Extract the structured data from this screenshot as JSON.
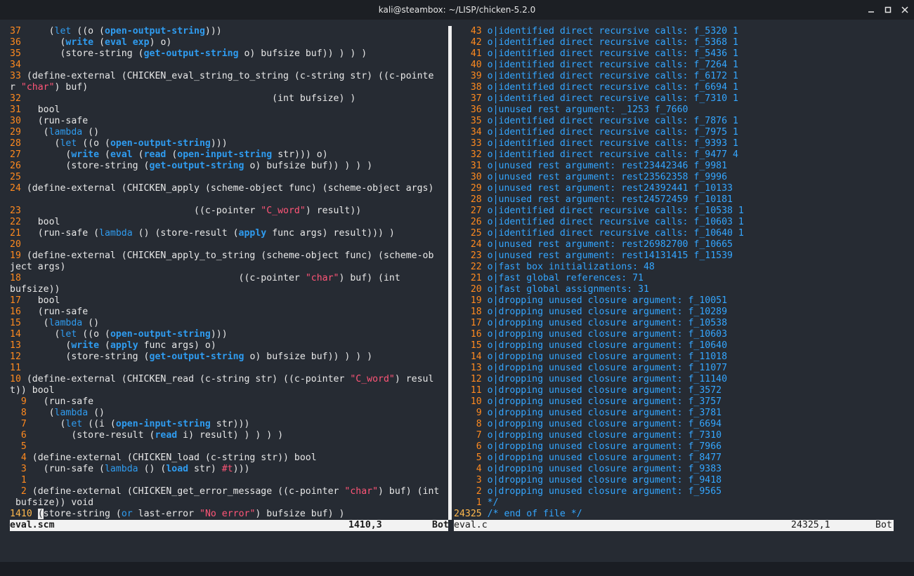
{
  "window": {
    "title": "kali@steambox: ~/LISP/chicken-5.2.0"
  },
  "left_pane": {
    "lines": [
      [
        [
          "ln",
          "37"
        ],
        [
          "pl",
          "     ("
        ],
        [
          "kw",
          "let"
        ],
        [
          "pl",
          " ((o ("
        ],
        [
          "fn",
          "open-output-string"
        ],
        [
          "pl",
          ")))"
        ]
      ],
      [
        [
          "ln",
          "36"
        ],
        [
          "pl",
          "       ("
        ],
        [
          "fn",
          "write"
        ],
        [
          "pl",
          " ("
        ],
        [
          "fn",
          "eval"
        ],
        [
          "pl",
          " "
        ],
        [
          "fn",
          "exp"
        ],
        [
          "pl",
          ") o)"
        ]
      ],
      [
        [
          "ln",
          "35"
        ],
        [
          "pl",
          "       (store-string ("
        ],
        [
          "fn",
          "get-output-string"
        ],
        [
          "pl",
          " o) bufsize buf)) ) ) )"
        ]
      ],
      [
        [
          "ln",
          "34"
        ]
      ],
      [
        [
          "ln",
          "33"
        ],
        [
          "pl",
          " (define-external (CHICKEN_eval_string_to_string (c-string str) ((c-pointe"
        ]
      ],
      [
        [
          "pl",
          "r "
        ],
        [
          "str",
          "\"char\""
        ],
        [
          "pl",
          ") buf)"
        ]
      ],
      [
        [
          "ln",
          "32"
        ],
        [
          "pl",
          "                                             (int bufsize) )"
        ]
      ],
      [
        [
          "ln",
          "31"
        ],
        [
          "pl",
          "   bool"
        ]
      ],
      [
        [
          "ln",
          "30"
        ],
        [
          "pl",
          "   (run-safe"
        ]
      ],
      [
        [
          "ln",
          "29"
        ],
        [
          "pl",
          "    ("
        ],
        [
          "kw",
          "lambda"
        ],
        [
          "pl",
          " ()"
        ]
      ],
      [
        [
          "ln",
          "28"
        ],
        [
          "pl",
          "      ("
        ],
        [
          "kw",
          "let"
        ],
        [
          "pl",
          " ((o ("
        ],
        [
          "fn",
          "open-output-string"
        ],
        [
          "pl",
          ")))"
        ]
      ],
      [
        [
          "ln",
          "27"
        ],
        [
          "pl",
          "        ("
        ],
        [
          "fn",
          "write"
        ],
        [
          "pl",
          " ("
        ],
        [
          "fn",
          "eval"
        ],
        [
          "pl",
          " ("
        ],
        [
          "fn",
          "read"
        ],
        [
          "pl",
          " ("
        ],
        [
          "fn",
          "open-input-string"
        ],
        [
          "pl",
          " str))) o)"
        ]
      ],
      [
        [
          "ln",
          "26"
        ],
        [
          "pl",
          "        (store-string ("
        ],
        [
          "fn",
          "get-output-string"
        ],
        [
          "pl",
          " o) bufsize buf)) ) ) )"
        ]
      ],
      [
        [
          "ln",
          "25"
        ]
      ],
      [
        [
          "ln",
          "24"
        ],
        [
          "pl",
          " (define-external (CHICKEN_apply (scheme-object func) (scheme-object args)"
        ]
      ],
      [],
      [
        [
          "ln",
          "23"
        ],
        [
          "pl",
          "                               ((c-pointer "
        ],
        [
          "str",
          "\"C_word\""
        ],
        [
          "pl",
          ") result))"
        ]
      ],
      [
        [
          "ln",
          "22"
        ],
        [
          "pl",
          "   bool"
        ]
      ],
      [
        [
          "ln",
          "21"
        ],
        [
          "pl",
          "   (run-safe ("
        ],
        [
          "kw",
          "lambda"
        ],
        [
          "pl",
          " () (store-result ("
        ],
        [
          "fn",
          "apply"
        ],
        [
          "pl",
          " func args) result))) )"
        ]
      ],
      [
        [
          "ln",
          "20"
        ]
      ],
      [
        [
          "ln",
          "19"
        ],
        [
          "pl",
          " (define-external (CHICKEN_apply_to_string (scheme-object func) (scheme-ob"
        ]
      ],
      [
        [
          "pl",
          "ject args)"
        ]
      ],
      [
        [
          "ln",
          "18"
        ],
        [
          "pl",
          "                                       ((c-pointer "
        ],
        [
          "str",
          "\"char\""
        ],
        [
          "pl",
          ") buf) (int"
        ]
      ],
      [
        [
          "pl",
          "bufsize))"
        ]
      ],
      [
        [
          "ln",
          "17"
        ],
        [
          "pl",
          "   bool"
        ]
      ],
      [
        [
          "ln",
          "16"
        ],
        [
          "pl",
          "   (run-safe"
        ]
      ],
      [
        [
          "ln",
          "15"
        ],
        [
          "pl",
          "    ("
        ],
        [
          "kw",
          "lambda"
        ],
        [
          "pl",
          " ()"
        ]
      ],
      [
        [
          "ln",
          "14"
        ],
        [
          "pl",
          "      ("
        ],
        [
          "kw",
          "let"
        ],
        [
          "pl",
          " ((o ("
        ],
        [
          "fn",
          "open-output-string"
        ],
        [
          "pl",
          ")))"
        ]
      ],
      [
        [
          "ln",
          "13"
        ],
        [
          "pl",
          "        ("
        ],
        [
          "fn",
          "write"
        ],
        [
          "pl",
          " ("
        ],
        [
          "fn",
          "apply"
        ],
        [
          "pl",
          " func args) o)"
        ]
      ],
      [
        [
          "ln",
          "12"
        ],
        [
          "pl",
          "        (store-string ("
        ],
        [
          "fn",
          "get-output-string"
        ],
        [
          "pl",
          " o) bufsize buf)) ) ) )"
        ]
      ],
      [
        [
          "ln",
          "11"
        ]
      ],
      [
        [
          "ln",
          "10"
        ],
        [
          "pl",
          " (define-external (CHICKEN_read (c-string str) ((c-pointer "
        ],
        [
          "str",
          "\"C_word\""
        ],
        [
          "pl",
          ") resul"
        ]
      ],
      [
        [
          "pl",
          "t)) bool"
        ]
      ],
      [
        [
          "ln",
          "  9"
        ],
        [
          "pl",
          "   (run-safe"
        ]
      ],
      [
        [
          "ln",
          "  8"
        ],
        [
          "pl",
          "    ("
        ],
        [
          "kw",
          "lambda"
        ],
        [
          "pl",
          " ()"
        ]
      ],
      [
        [
          "ln",
          "  7"
        ],
        [
          "pl",
          "      ("
        ],
        [
          "kw",
          "let"
        ],
        [
          "pl",
          " ((i ("
        ],
        [
          "fn",
          "open-input-string"
        ],
        [
          "pl",
          " str)))"
        ]
      ],
      [
        [
          "ln",
          "  6"
        ],
        [
          "pl",
          "        (store-result ("
        ],
        [
          "fn",
          "read"
        ],
        [
          "pl",
          " i) result) ) ) ) )"
        ]
      ],
      [
        [
          "ln",
          "  5"
        ]
      ],
      [
        [
          "ln",
          "  4"
        ],
        [
          "pl",
          " (define-external (CHICKEN_load (c-string str)) bool"
        ]
      ],
      [
        [
          "ln",
          "  3"
        ],
        [
          "pl",
          "   (run-safe ("
        ],
        [
          "kw",
          "lambda"
        ],
        [
          "pl",
          " () ("
        ],
        [
          "fn",
          "load"
        ],
        [
          "pl",
          " str) "
        ],
        [
          "str",
          "#t"
        ],
        [
          "pl",
          ")))"
        ]
      ],
      [
        [
          "ln",
          "  1"
        ]
      ],
      [
        [
          "ln",
          "  2"
        ],
        [
          "pl",
          " (define-external (CHICKEN_get_error_message ((c-pointer "
        ],
        [
          "str",
          "\"char\""
        ],
        [
          "pl",
          ") buf) (int"
        ]
      ],
      [
        [
          "pl",
          " bufsize)) void"
        ]
      ],
      [
        [
          "ln-cur",
          "1410"
        ],
        [
          "pl",
          " "
        ],
        [
          "cursor",
          "("
        ],
        [
          "pl",
          "store-string ("
        ],
        [
          "kw",
          "or"
        ],
        [
          "pl",
          " last-error "
        ],
        [
          "str",
          "\"No error\""
        ],
        [
          "pl",
          ") bufsize buf) )"
        ]
      ]
    ]
  },
  "right_pane": {
    "lines": [
      [
        [
          "ln",
          "   43"
        ],
        [
          "pl",
          " "
        ],
        [
          "com",
          "o|identified direct recursive calls: f_5320 1"
        ]
      ],
      [
        [
          "ln",
          "   42"
        ],
        [
          "pl",
          " "
        ],
        [
          "com",
          "o|identified direct recursive calls: f_5368 1"
        ]
      ],
      [
        [
          "ln",
          "   41"
        ],
        [
          "pl",
          " "
        ],
        [
          "com",
          "o|identified direct recursive calls: f_5436 1"
        ]
      ],
      [
        [
          "ln",
          "   40"
        ],
        [
          "pl",
          " "
        ],
        [
          "com",
          "o|identified direct recursive calls: f_7264 1"
        ]
      ],
      [
        [
          "ln",
          "   39"
        ],
        [
          "pl",
          " "
        ],
        [
          "com",
          "o|identified direct recursive calls: f_6172 1"
        ]
      ],
      [
        [
          "ln",
          "   38"
        ],
        [
          "pl",
          " "
        ],
        [
          "com",
          "o|identified direct recursive calls: f_6694 1"
        ]
      ],
      [
        [
          "ln",
          "   37"
        ],
        [
          "pl",
          " "
        ],
        [
          "com",
          "o|identified direct recursive calls: f_7310 1"
        ]
      ],
      [
        [
          "ln",
          "   36"
        ],
        [
          "pl",
          " "
        ],
        [
          "com",
          "o|unused rest argument: _1253 f_7660"
        ]
      ],
      [
        [
          "ln",
          "   35"
        ],
        [
          "pl",
          " "
        ],
        [
          "com",
          "o|identified direct recursive calls: f_7876 1"
        ]
      ],
      [
        [
          "ln",
          "   34"
        ],
        [
          "pl",
          " "
        ],
        [
          "com",
          "o|identified direct recursive calls: f_7975 1"
        ]
      ],
      [
        [
          "ln",
          "   33"
        ],
        [
          "pl",
          " "
        ],
        [
          "com",
          "o|identified direct recursive calls: f_9393 1"
        ]
      ],
      [
        [
          "ln",
          "   32"
        ],
        [
          "pl",
          " "
        ],
        [
          "com",
          "o|identified direct recursive calls: f_9477 4"
        ]
      ],
      [
        [
          "ln",
          "   31"
        ],
        [
          "pl",
          " "
        ],
        [
          "com",
          "o|unused rest argument: rest23442346 f_9981"
        ]
      ],
      [
        [
          "ln",
          "   30"
        ],
        [
          "pl",
          " "
        ],
        [
          "com",
          "o|unused rest argument: rest23562358 f_9996"
        ]
      ],
      [
        [
          "ln",
          "   29"
        ],
        [
          "pl",
          " "
        ],
        [
          "com",
          "o|unused rest argument: rest24392441 f_10133"
        ]
      ],
      [
        [
          "ln",
          "   28"
        ],
        [
          "pl",
          " "
        ],
        [
          "com",
          "o|unused rest argument: rest24572459 f_10181"
        ]
      ],
      [
        [
          "ln",
          "   27"
        ],
        [
          "pl",
          " "
        ],
        [
          "com",
          "o|identified direct recursive calls: f_10538 1"
        ]
      ],
      [
        [
          "ln",
          "   26"
        ],
        [
          "pl",
          " "
        ],
        [
          "com",
          "o|identified direct recursive calls: f_10603 1"
        ]
      ],
      [
        [
          "ln",
          "   25"
        ],
        [
          "pl",
          " "
        ],
        [
          "com",
          "o|identified direct recursive calls: f_10640 1"
        ]
      ],
      [
        [
          "ln",
          "   24"
        ],
        [
          "pl",
          " "
        ],
        [
          "com",
          "o|unused rest argument: rest26982700 f_10665"
        ]
      ],
      [
        [
          "ln",
          "   23"
        ],
        [
          "pl",
          " "
        ],
        [
          "com",
          "o|unused rest argument: rest14131415 f_11539"
        ]
      ],
      [
        [
          "ln",
          "   22"
        ],
        [
          "pl",
          " "
        ],
        [
          "com",
          "o|fast box initializations: 48"
        ]
      ],
      [
        [
          "ln",
          "   21"
        ],
        [
          "pl",
          " "
        ],
        [
          "com",
          "o|fast global references: 71"
        ]
      ],
      [
        [
          "ln",
          "   20"
        ],
        [
          "pl",
          " "
        ],
        [
          "com",
          "o|fast global assignments: 31"
        ]
      ],
      [
        [
          "ln",
          "   19"
        ],
        [
          "pl",
          " "
        ],
        [
          "com",
          "o|dropping unused closure argument: f_10051"
        ]
      ],
      [
        [
          "ln",
          "   18"
        ],
        [
          "pl",
          " "
        ],
        [
          "com",
          "o|dropping unused closure argument: f_10289"
        ]
      ],
      [
        [
          "ln",
          "   17"
        ],
        [
          "pl",
          " "
        ],
        [
          "com",
          "o|dropping unused closure argument: f_10538"
        ]
      ],
      [
        [
          "ln",
          "   16"
        ],
        [
          "pl",
          " "
        ],
        [
          "com",
          "o|dropping unused closure argument: f_10603"
        ]
      ],
      [
        [
          "ln",
          "   15"
        ],
        [
          "pl",
          " "
        ],
        [
          "com",
          "o|dropping unused closure argument: f_10640"
        ]
      ],
      [
        [
          "ln",
          "   14"
        ],
        [
          "pl",
          " "
        ],
        [
          "com",
          "o|dropping unused closure argument: f_11018"
        ]
      ],
      [
        [
          "ln",
          "   13"
        ],
        [
          "pl",
          " "
        ],
        [
          "com",
          "o|dropping unused closure argument: f_11077"
        ]
      ],
      [
        [
          "ln",
          "   12"
        ],
        [
          "pl",
          " "
        ],
        [
          "com",
          "o|dropping unused closure argument: f_11140"
        ]
      ],
      [
        [
          "ln",
          "   11"
        ],
        [
          "pl",
          " "
        ],
        [
          "com",
          "o|dropping unused closure argument: f_3572"
        ]
      ],
      [
        [
          "ln",
          "   10"
        ],
        [
          "pl",
          " "
        ],
        [
          "com",
          "o|dropping unused closure argument: f_3757"
        ]
      ],
      [
        [
          "ln",
          "    9"
        ],
        [
          "pl",
          " "
        ],
        [
          "com",
          "o|dropping unused closure argument: f_3781"
        ]
      ],
      [
        [
          "ln",
          "    8"
        ],
        [
          "pl",
          " "
        ],
        [
          "com",
          "o|dropping unused closure argument: f_6694"
        ]
      ],
      [
        [
          "ln",
          "    7"
        ],
        [
          "pl",
          " "
        ],
        [
          "com",
          "o|dropping unused closure argument: f_7310"
        ]
      ],
      [
        [
          "ln",
          "    6"
        ],
        [
          "pl",
          " "
        ],
        [
          "com",
          "o|dropping unused closure argument: f_7966"
        ]
      ],
      [
        [
          "ln",
          "    5"
        ],
        [
          "pl",
          " "
        ],
        [
          "com",
          "o|dropping unused closure argument: f_8477"
        ]
      ],
      [
        [
          "ln",
          "    4"
        ],
        [
          "pl",
          " "
        ],
        [
          "com",
          "o|dropping unused closure argument: f_9383"
        ]
      ],
      [
        [
          "ln",
          "    3"
        ],
        [
          "pl",
          " "
        ],
        [
          "com",
          "o|dropping unused closure argument: f_9418"
        ]
      ],
      [
        [
          "ln",
          "    2"
        ],
        [
          "pl",
          " "
        ],
        [
          "com",
          "o|dropping unused closure argument: f_9565"
        ]
      ],
      [
        [
          "ln",
          "    1"
        ],
        [
          "pl",
          " "
        ],
        [
          "com",
          "*/"
        ]
      ],
      [
        [
          "ln-cur",
          "24325"
        ],
        [
          "pl",
          " "
        ],
        [
          "com",
          "/* end of file */"
        ]
      ]
    ]
  },
  "status": {
    "left": {
      "filename": "eval.scm",
      "position": "1410,3",
      "scroll": "Bot"
    },
    "right": {
      "filename": "eval.c",
      "position": "24325,1",
      "scroll": "Bot"
    }
  },
  "icons": {
    "minimize": "minimize-icon",
    "maximize": "maximize-icon",
    "close": "close-icon"
  }
}
